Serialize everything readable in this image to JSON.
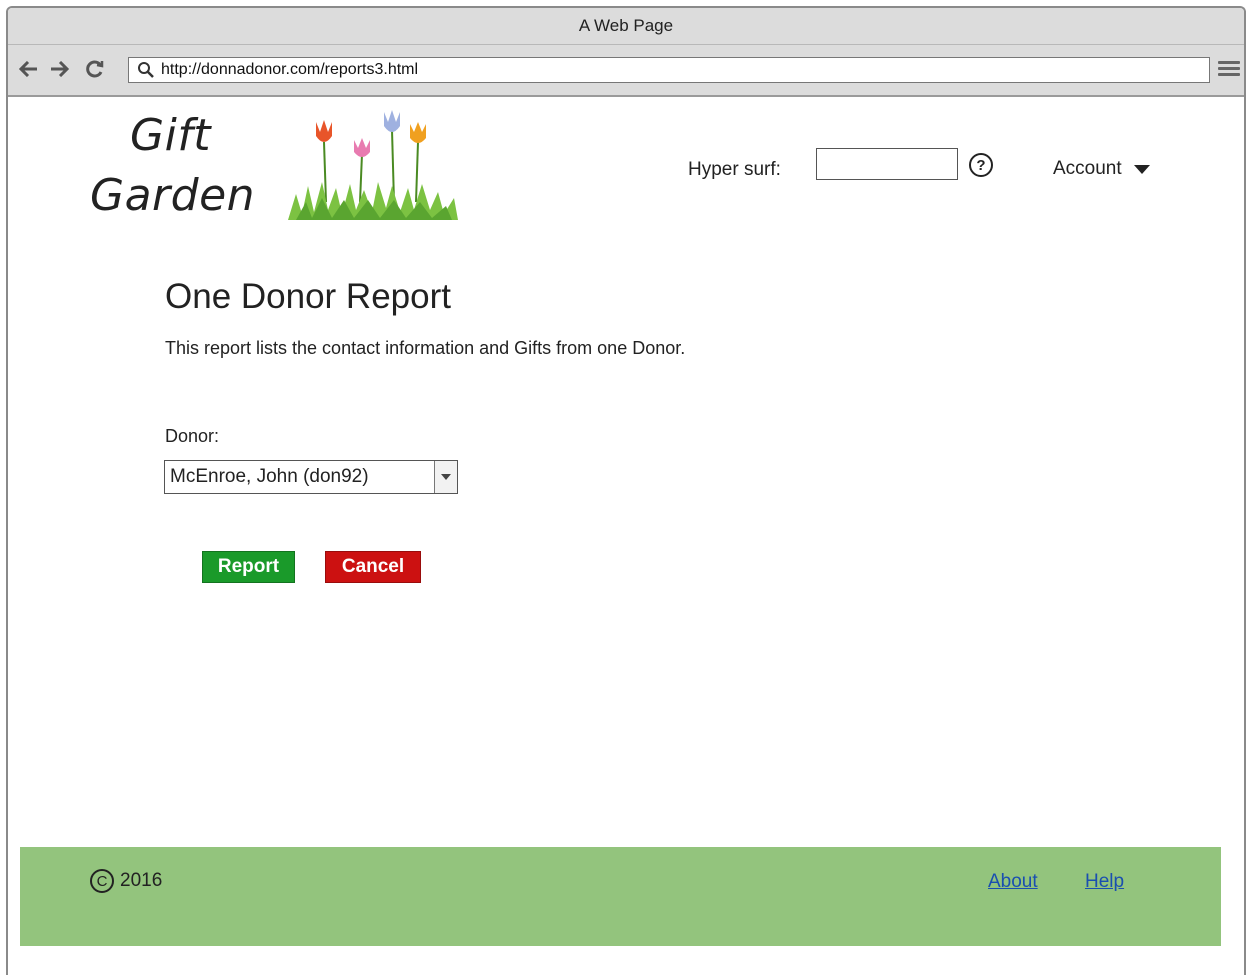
{
  "browser": {
    "window_title": "A Web Page",
    "url": "http://donnadonor.com/reports3.html"
  },
  "header": {
    "logo_line1": "Gift",
    "logo_line2": "Garden",
    "hypersurf_label": "Hyper surf:",
    "hypersurf_value": "",
    "help_icon_label": "?",
    "account_label": "Account"
  },
  "main": {
    "title": "One Donor Report",
    "description": "This report lists the contact information and Gifts from one Donor.",
    "donor_label": "Donor:",
    "donor_selected": "McEnroe, John (don92)",
    "report_button": "Report",
    "cancel_button": "Cancel"
  },
  "footer": {
    "copyright_symbol": "C",
    "year": "2016",
    "links": [
      "About",
      "Help"
    ]
  },
  "colors": {
    "report_button": "#1a9a2a",
    "cancel_button": "#cc1111",
    "footer_bg": "#93c47d",
    "link": "#1a4fb0"
  },
  "icons": {
    "back": "arrow-left-icon",
    "forward": "arrow-right-icon",
    "reload": "reload-icon",
    "search": "search-icon",
    "menu": "hamburger-menu-icon",
    "help": "help-icon",
    "account_caret": "caret-down-icon",
    "logo_art": "tulips-icon"
  }
}
